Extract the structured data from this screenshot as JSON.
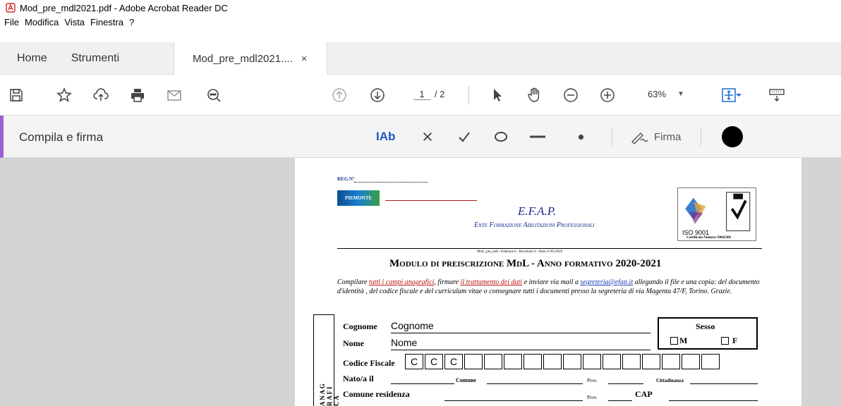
{
  "window": {
    "title": "Mod_pre_mdl2021.pdf - Adobe Acrobat Reader DC"
  },
  "menu": [
    "File",
    "Modifica",
    "Vista",
    "Finestra",
    "?"
  ],
  "tabs": {
    "home": "Home",
    "tools": "Strumenti",
    "document": "Mod_pre_mdl2021....",
    "close": "×"
  },
  "toolbar": {
    "icons": [
      "save-icon",
      "star-icon",
      "cloud-upload-icon",
      "print-icon",
      "mail-icon",
      "zoom-search-icon",
      "arrow-up-circle-icon",
      "arrow-down-circle-icon",
      "pointer-icon",
      "hand-icon",
      "zoom-out-icon",
      "zoom-in-icon",
      "fit-page-icon",
      "keyboard-icon"
    ],
    "page_current": "1",
    "page_total": "/ 2",
    "zoom": "63%"
  },
  "fill_sign": {
    "title": "Compila e firma",
    "text_tool": "IAb",
    "sign_label": "Firma"
  },
  "document": {
    "reg": "REG.N°",
    "logo_text": "PIEMONTE",
    "org_name": "E.F.A.P.",
    "org_full": "Ente Formazione Abilitazioni Professionali",
    "cert_line1": "ISO 9001",
    "cert_line2": "Certificato Numero 39062306",
    "revision": "Mod._pre_mdl - Edizione 6 - Revisione 0 - Data 21/05/2019",
    "heading": "Modulo di preiscrizione MdL - Anno formativo 2020-2021",
    "instr_1": "Compilare ",
    "instr_2": "tutti i campi anagrafici",
    "instr_3": ", firmare ",
    "instr_4": "il trattamento dei dati",
    "instr_5": " e inviare via mail a ",
    "instr_email": "segreteria@efap.it",
    "instr_6": " allegando il file e una copia: del documento d'identità , del codice fiscale e del curriculum vitae o consegnare tutti i documenti presso la segreteria di via Magenta 47/F, Torino. Grazie.",
    "side_label": "A N A G R A F I C A",
    "cognome_label": "Cognome",
    "cognome_value": "Cognome",
    "nome_label": "Nome",
    "nome_value": "Nome",
    "sesso_label": "Sesso",
    "sesso_m": "M",
    "sesso_f": "F",
    "cf_label": "Codice Fiscale",
    "cf_cells": [
      "C",
      "C",
      "C",
      "",
      "",
      "",
      "",
      "",
      "",
      "",
      "",
      "",
      "",
      "",
      "",
      ""
    ],
    "nato_label": "Nato/a il",
    "comune_label": "Comune",
    "prov_label": "Prov.",
    "citt_label": "Cittadinanza",
    "residenza_label": "Comune residenza",
    "prov2_label": "Prov.",
    "cap_label": "CAP"
  }
}
